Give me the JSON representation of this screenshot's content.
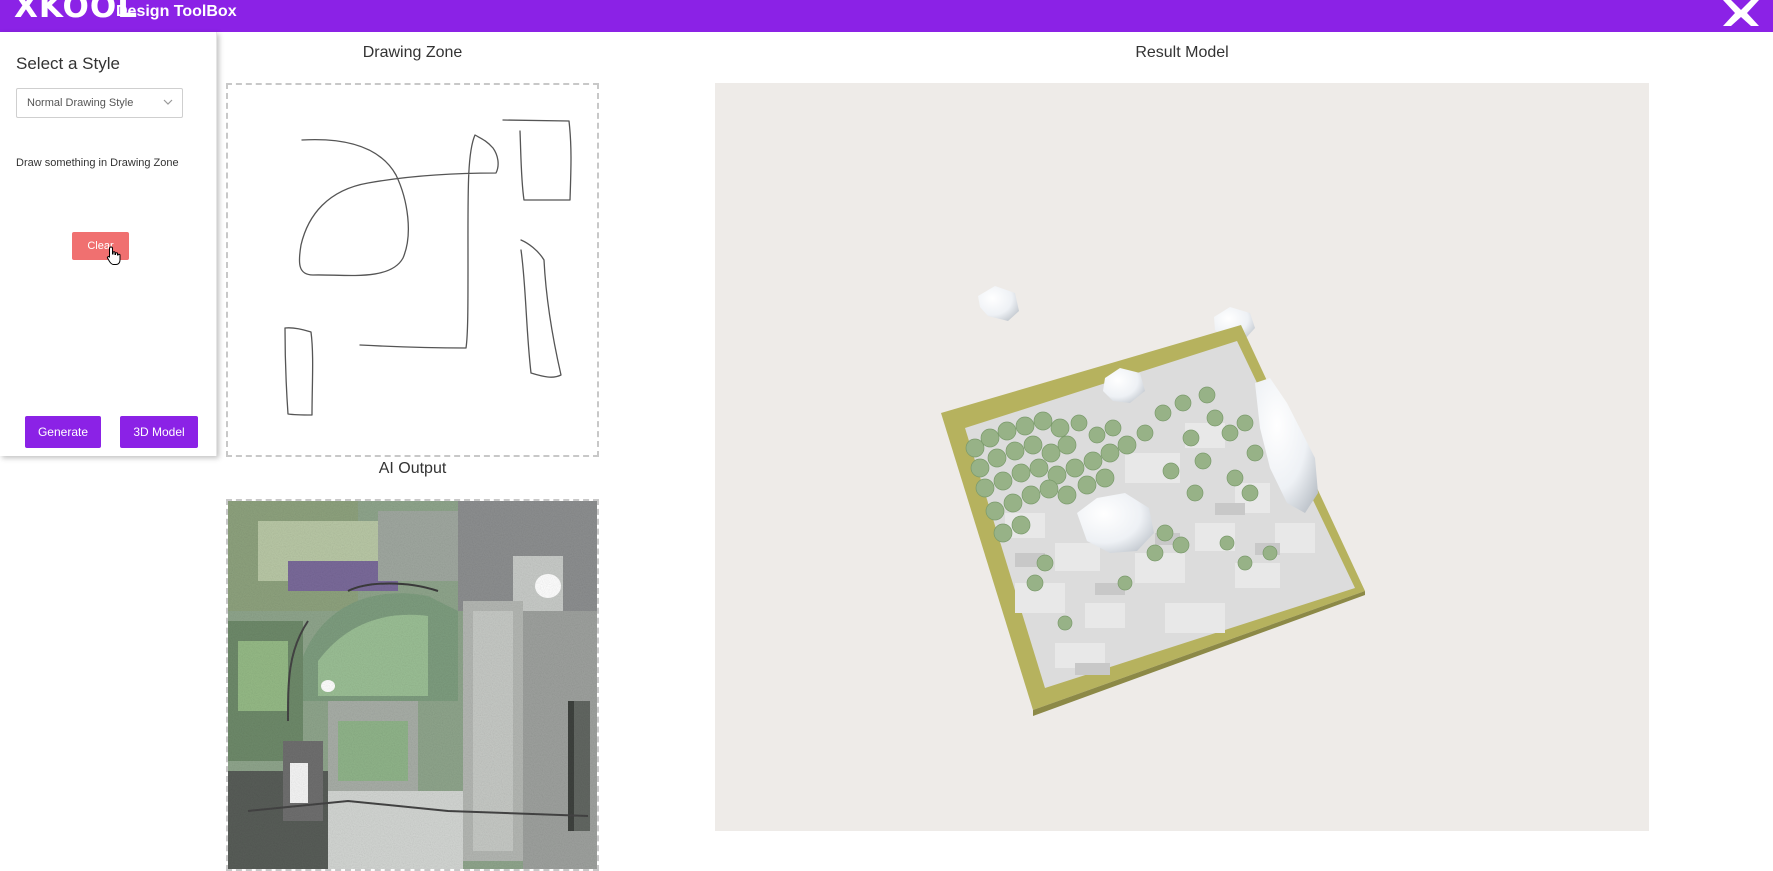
{
  "header": {
    "logo_text": "XKOOL",
    "subtitle": "Design ToolBox",
    "close_icon": "close-x-icon",
    "bg_color": "#8b22e6"
  },
  "sidebar": {
    "title": "Select a Style",
    "style_select": {
      "selected": "Normal Drawing Style",
      "icon": "chevron-down-icon"
    },
    "instructions": "Draw something in Drawing Zone",
    "clear_label": "Clear",
    "clear_color": "#f07070",
    "generate_label": "Generate",
    "model_label": "3D Model",
    "accent_color": "#8b22e6"
  },
  "drawing_zone": {
    "label": "Drawing Zone"
  },
  "ai_output": {
    "label": "AI Output"
  },
  "result_model": {
    "label": "Result Model",
    "background": "#eeebe8",
    "base_color": "#b6b25e",
    "tree_color": "#97b287",
    "rock_color": "#f4f6f8"
  }
}
